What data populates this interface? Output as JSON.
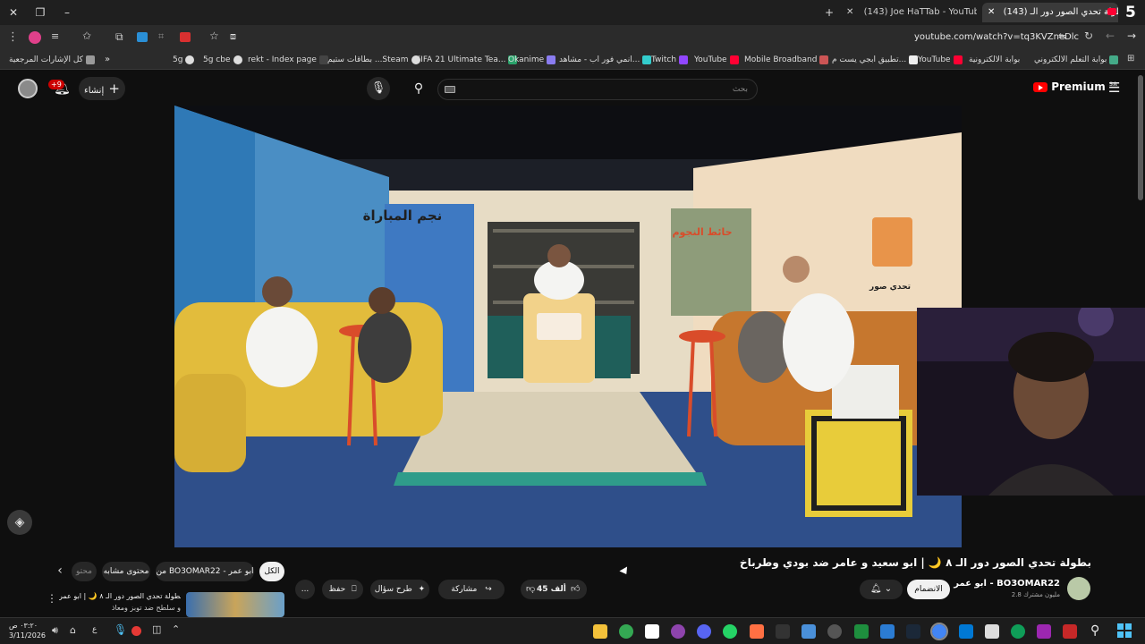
{
  "browser": {
    "tabs": [
      {
        "label": "(143) Joe HaTTab - YouTube"
      },
      {
        "label": "(143) بطولة تحدي الصور دور الـ"
      }
    ],
    "tab_count_badge": "5",
    "url": "youtube.com/watch?v=tq3KVZneDlc"
  },
  "bookmarks": {
    "items": [
      "كل الإشارات المرجعية",
      "5g",
      "5g cbe",
      "rekt - Index page",
      "بطاقات ستيم ...Steam",
      "FIFA 21 Ultimate Tea...",
      "Okanime",
      "انمي فور اب - مشاهد...",
      "Twitch",
      "YouTube",
      "Mobile Broadband",
      "تطبيق ابجي يست م...",
      "YouTube",
      "بوابة الالكترونية",
      "بوابة التعلم الالكتروني"
    ]
  },
  "youtube": {
    "create_label": "إنشاء",
    "notif_badge": "+9",
    "search_placeholder": "بحث",
    "search_locale": "SA",
    "premium_label": "Premium",
    "video_title": "بطولة تحدي الصور دور الـ ٨ 🌙 | ابو سعيد و عامر ضد بودي وطرباخ",
    "channel_name": "ابو عمر - BO3OMAR22",
    "subscribers": "2.8 مليون مشترك",
    "join_label": "الانضمام",
    "likes": "45 ألف",
    "share_label": "مشاركة",
    "ask_label": "طرح سؤال",
    "save_label": "حفظ",
    "more_label": "...",
    "chips": [
      "الكل",
      "من BO3OMAR22 - ابو عمر",
      "محتوى مشابه",
      "محتو"
    ],
    "next_video_title": "بطولة تحدي الصور دور الـ ٨ 🌙 | ابو عمر",
    "next_video_sub": "و سلطح ضد توبز ومعاذ"
  },
  "scene": {
    "sign_left": "نجم المباراة",
    "sign_center": "حائط النجوم",
    "sign_right": "تحدي صور"
  },
  "taskbar": {
    "time": "٠٣:٢٠ ص",
    "date": "3/11/2026",
    "lang": "ع"
  },
  "colors": {
    "yt_red": "#ff0000",
    "accent_blue": "#3ea6ff"
  }
}
